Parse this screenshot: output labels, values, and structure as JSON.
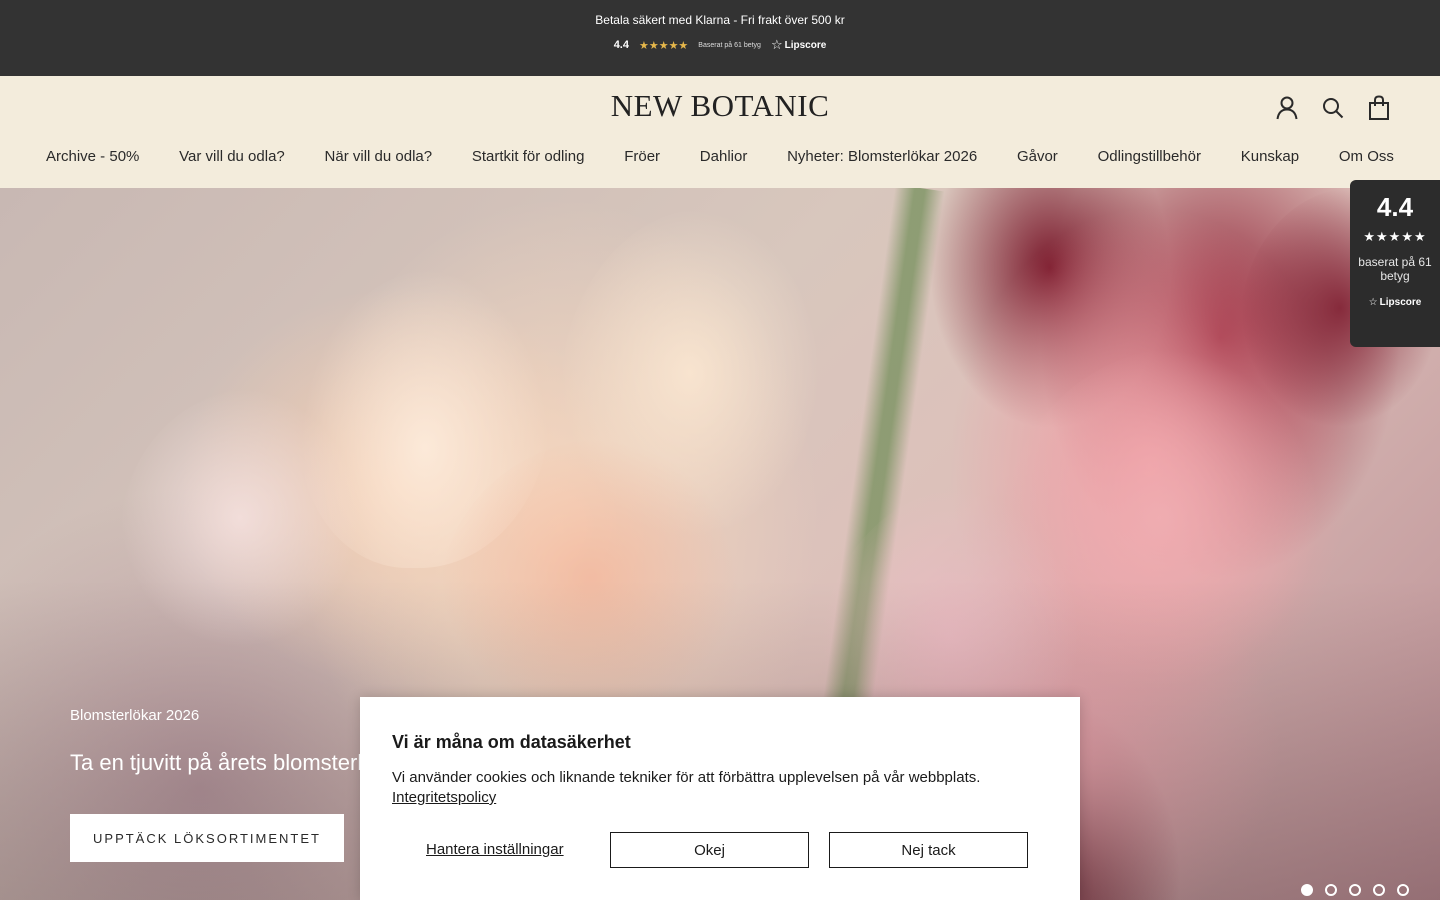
{
  "announcement": {
    "text": "Betala säkert med Klarna - Fri frakt över 500 kr",
    "rating_score": "4.4",
    "rating_stars": "★★★★★",
    "rating_based": "Baserat på 61 betyg",
    "rating_provider": "Lipscore"
  },
  "header": {
    "logo": "NEW BOTANIC",
    "icons": [
      "account-icon",
      "search-icon",
      "cart-bag-icon"
    ]
  },
  "nav": {
    "items": [
      "Archive - 50%",
      "Var vill du odla?",
      "När vill du odla?",
      "Startkit för odling",
      "Fröer",
      "Dahlior",
      "Nyheter: Blomsterlökar 2026",
      "Gåvor",
      "Odlingstillbehör",
      "Kunskap",
      "Om Oss"
    ]
  },
  "hero": {
    "eyebrow": "Blomsterlökar 2026",
    "title": "Ta en tjuvitt på årets blomsterl",
    "cta": "UPPTÄCK LÖKSORTIMENTET",
    "slides_total": 5,
    "active_slide": 1
  },
  "badge": {
    "score": "4.4",
    "stars": "★★★★★",
    "text": "baserat på 61 betyg",
    "provider": "Lipscore"
  },
  "cookie": {
    "title": "Vi är måna om datasäkerhet",
    "body": "Vi använder cookies och liknande tekniker för att förbättra upplevelsen på vår webbplats.",
    "policy_link": "Integritetspolicy",
    "manage": "Hantera inställningar",
    "accept": "Okej",
    "decline": "Nej tack"
  },
  "colors": {
    "announcement_bg": "#333333",
    "header_bg": "#f3ecdc",
    "star_gold": "#e6b74a",
    "badge_bg": "#2c2c2c"
  }
}
